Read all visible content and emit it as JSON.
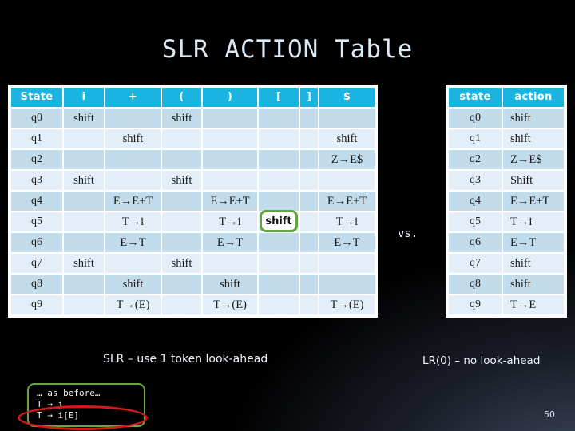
{
  "slide": {
    "title": "SLR ACTION Table",
    "page_number": "50",
    "vs_label": "vs."
  },
  "main_table": {
    "headers": [
      "State",
      "i",
      "+",
      "(",
      ")",
      "[",
      "]",
      "$"
    ],
    "rows": [
      {
        "state": "q0",
        "cells": [
          "shift",
          "",
          "shift",
          "",
          "",
          "",
          ""
        ]
      },
      {
        "state": "q1",
        "cells": [
          "",
          "shift",
          "",
          "",
          "",
          "",
          "shift"
        ]
      },
      {
        "state": "q2",
        "cells": [
          "",
          "",
          "",
          "",
          "",
          "",
          "Z→E$"
        ]
      },
      {
        "state": "q3",
        "cells": [
          "shift",
          "",
          "shift",
          "",
          "",
          "",
          ""
        ]
      },
      {
        "state": "q4",
        "cells": [
          "",
          "E→E+T",
          "",
          "E→E+T",
          "",
          "",
          "E→E+T"
        ]
      },
      {
        "state": "q5",
        "cells": [
          "",
          "T→i",
          "",
          "T→i",
          "shift",
          "",
          "T→i"
        ],
        "highlight_col": 4
      },
      {
        "state": "q6",
        "cells": [
          "",
          "E→T",
          "",
          "E→T",
          "",
          "",
          "E→T"
        ]
      },
      {
        "state": "q7",
        "cells": [
          "shift",
          "",
          "shift",
          "",
          "",
          "",
          ""
        ]
      },
      {
        "state": "q8",
        "cells": [
          "",
          "shift",
          "",
          "shift",
          "",
          "",
          ""
        ]
      },
      {
        "state": "q9",
        "cells": [
          "",
          "T→(E)",
          "",
          "T→(E)",
          "",
          "",
          "T→(E)"
        ]
      }
    ]
  },
  "side_table": {
    "headers": [
      "state",
      "action"
    ],
    "rows": [
      {
        "state": "q0",
        "action": "shift"
      },
      {
        "state": "q1",
        "action": "shift"
      },
      {
        "state": "q2",
        "action": "Z→E$"
      },
      {
        "state": "q3",
        "action": "Shift"
      },
      {
        "state": "q4",
        "action": "E→E+T"
      },
      {
        "state": "q5",
        "action": "T→i"
      },
      {
        "state": "q6",
        "action": "E→T"
      },
      {
        "state": "q7",
        "action": "shift"
      },
      {
        "state": "q8",
        "action": "shift"
      },
      {
        "state": "q9",
        "action": "T→E"
      }
    ]
  },
  "captions": {
    "left": "SLR – use 1 token look-ahead",
    "right": "LR(0) – no look-ahead"
  },
  "grammar_box": {
    "lines": [
      "… as before…",
      "T → i",
      "T → i[E]"
    ],
    "circled_line_index": 2
  },
  "colors": {
    "header_blue": "#1bb3e0",
    "row_odd": "#c2dcec",
    "row_even": "#e3eef8",
    "highlight_green": "#61a53c",
    "ellipse_red": "#d51818",
    "title_text": "#dceaf6"
  }
}
